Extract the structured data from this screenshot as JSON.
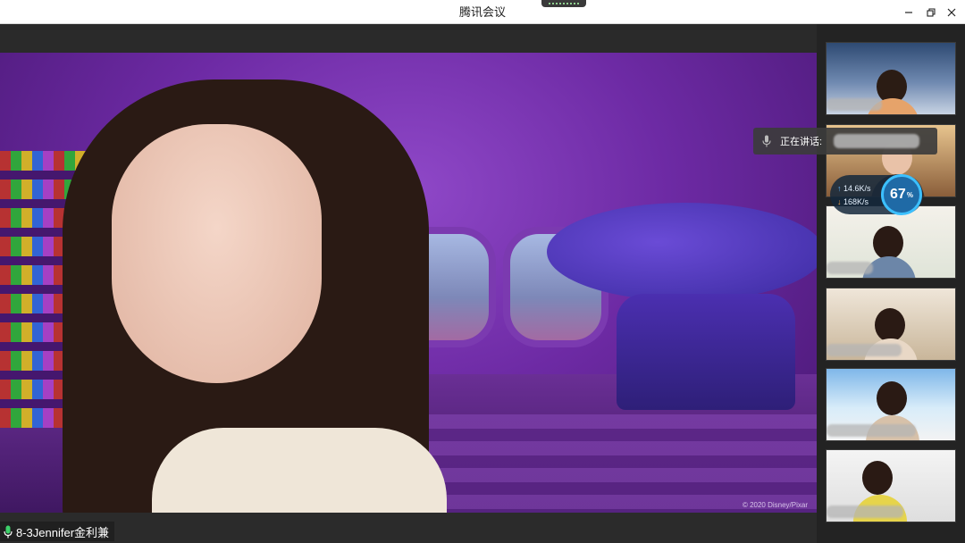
{
  "window": {
    "title": "腾讯会议",
    "controls": {
      "minimize_icon": "minimize-icon",
      "maximize_icon": "restore-icon",
      "close_icon": "close-icon"
    }
  },
  "main_video": {
    "speaker_name": "8-3Jennifer金利兼",
    "watermark": "© 2020 Disney/Pixar"
  },
  "speaking_indicator": {
    "label": "正在讲话:"
  },
  "network_widget": {
    "upload": "14.6",
    "upload_unit": "K/s",
    "download": "168",
    "download_unit": "K/s",
    "percent": "67",
    "percent_unit": "%"
  },
  "participants": [
    {
      "index": 1
    },
    {
      "index": 2
    },
    {
      "index": 3
    },
    {
      "index": 4
    },
    {
      "index": 5
    },
    {
      "index": 6
    }
  ],
  "colors": {
    "accent": "#3cc0ff",
    "titlebar_bg": "#ffffff",
    "app_bg": "#232323"
  }
}
